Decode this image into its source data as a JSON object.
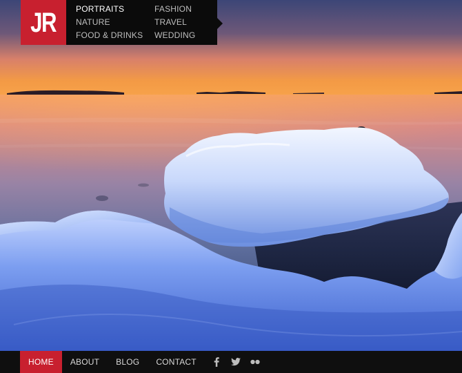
{
  "logo": {
    "text": "JR",
    "color": "#c8202f"
  },
  "category_menu": {
    "items": [
      {
        "label": "PORTRAITS",
        "active": true
      },
      {
        "label": "FASHION",
        "active": false
      },
      {
        "label": "NATURE",
        "active": false
      },
      {
        "label": "TRAVEL",
        "active": false
      },
      {
        "label": "FOOD & DRINKS",
        "active": false
      },
      {
        "label": "WEDDING",
        "active": false
      }
    ]
  },
  "nav": {
    "items": [
      {
        "label": "HOME",
        "active": true
      },
      {
        "label": "ABOUT",
        "active": false
      },
      {
        "label": "BLOG",
        "active": false
      },
      {
        "label": "CONTACT",
        "active": false
      }
    ]
  },
  "social": [
    {
      "icon": "facebook-icon"
    },
    {
      "icon": "twitter-icon"
    },
    {
      "icon": "flickr-icon"
    }
  ],
  "colors": {
    "accent": "#c8202f",
    "bar": "#0f0f0f"
  }
}
